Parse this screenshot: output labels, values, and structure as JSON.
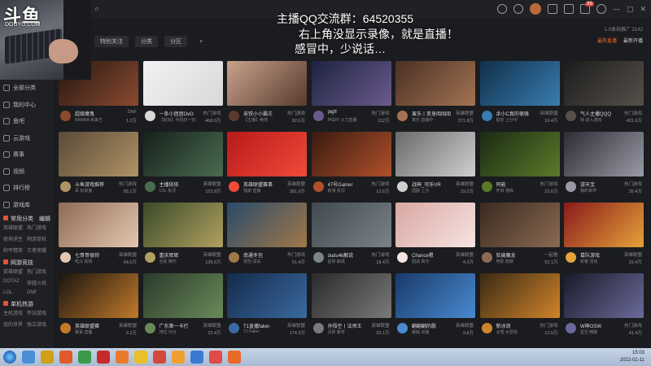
{
  "app": {
    "brand": "斗鱼",
    "brand_url": "DOUYU.COM",
    "top_meta": "1.0本站推广 2142",
    "notification_count": "99"
  },
  "overlay": {
    "line1": "主播QQ交流群：64520355",
    "line2": "右上角没显示录像，就是直播！",
    "line3": "感冒中，少说话…"
  },
  "filters": [
    "特别关注",
    "分类",
    "分区"
  ],
  "right_actions": {
    "hot": "最热直播",
    "new": "最新开播"
  },
  "sidebar": {
    "items": [
      {
        "label": "全部分类",
        "icon": "grid-icon"
      },
      {
        "label": "我的中心",
        "icon": "user-icon"
      },
      {
        "label": "鱼吧",
        "icon": "fish-icon"
      },
      {
        "label": "云游戏",
        "icon": "cloud-icon"
      },
      {
        "label": "赛事",
        "icon": "trophy-icon"
      },
      {
        "label": "视频",
        "icon": "video-icon"
      },
      {
        "label": "排行榜",
        "icon": "rank-icon"
      },
      {
        "label": "游戏库",
        "icon": "gamepad-icon"
      }
    ],
    "sections": [
      {
        "title": "常用分类",
        "action": "编辑",
        "subs": [
          "英雄联盟",
          "热门游戏",
          "绝地求生",
          "网游单机",
          "和平精英",
          "王者荣耀"
        ]
      },
      {
        "title": "网游竞技",
        "action": "",
        "subs": [
          "英雄联盟",
          "热门游戏",
          "DOTA2",
          "穿越火线",
          "LOL",
          "DNF"
        ]
      },
      {
        "title": "单机热游",
        "action": "",
        "subs": [
          "主机游戏",
          "怀旧游戏",
          "我的世界",
          "独立游戏"
        ]
      }
    ],
    "bottom": [
      {
        "label": "开播"
      },
      {
        "label": "直播"
      }
    ]
  },
  "cards": [
    {
      "name": "超级魔鬼",
      "cat": "DNF",
      "sub": "NNNNA 未来已",
      "views": "1.2万",
      "thumb": [
        "#241613",
        "#8a4a2e"
      ]
    },
    {
      "name": "一条小团团OvO",
      "cat": "热门游戏",
      "sub": "【好好】手机扫一扫",
      "views": "468.0万",
      "thumb": [
        "#f2f2f2",
        "#d8d8d8"
      ]
    },
    {
      "name": "采铁小小霸王",
      "cat": "热门游戏",
      "sub": "【主播】绝地",
      "views": "92.6万",
      "thumb": [
        "#c7a38c",
        "#5a3a2f"
      ]
    },
    {
      "name": "pigff",
      "cat": "热门游戏",
      "sub": "PIGFF 火力直播",
      "views": "112万",
      "thumb": [
        "#1e2340",
        "#6a5a8c"
      ]
    },
    {
      "name": "寅乐丨变身阅阅阅",
      "cat": "英雄联盟",
      "sub": "寅乐 直播中",
      "views": "371.8万",
      "thumb": [
        "#4a3025",
        "#a37352"
      ]
    },
    {
      "name": "余小C真的很强",
      "cat": "英雄联盟",
      "sub": "稳定 上分中",
      "views": "10.4万",
      "thumb": [
        "#10304a",
        "#3a7cb0"
      ]
    },
    {
      "name": "气人主播QQQ",
      "cat": "热门游戏",
      "sub": "快 进入游戏",
      "views": "431.6万",
      "thumb": [
        "#1c1c1c",
        "#55504a"
      ]
    },
    {
      "name": "斗鱼游戏推荐",
      "cat": "热门游戏",
      "sub": "百 玩家鬼",
      "views": "85.1万",
      "thumb": [
        "#5a4a38",
        "#b09366"
      ]
    },
    {
      "name": "主播依依",
      "cat": "英雄联盟",
      "sub": "LOL 实况",
      "views": "153.8万",
      "thumb": [
        "#16211c",
        "#4b6b4f"
      ]
    },
    {
      "name": "英雄联盟赛事",
      "cat": "英雄联盟",
      "sub": "独家 直播",
      "views": "281.9万",
      "thumb": [
        "#b81a1a",
        "#f04a3a"
      ]
    },
    {
      "name": "47号Gamer",
      "cat": "热门游戏",
      "sub": "新游 实况",
      "views": "12.6万",
      "thumb": [
        "#3a1a10",
        "#b0502a"
      ]
    },
    {
      "name": "战神_可乐VR",
      "cat": "英雄联盟",
      "sub": "国服 上分",
      "views": "19.2万",
      "thumb": [
        "#6a6a6a",
        "#d0cfd0"
      ]
    },
    {
      "name": "阿能",
      "cat": "热门游戏",
      "sub": "怀旧 游戏",
      "views": "22.6万",
      "thumb": [
        "#1a2b14",
        "#5a7a2a"
      ]
    },
    {
      "name": "游天宝",
      "cat": "热门游戏",
      "sub": "我的世界",
      "views": "35.4万",
      "thumb": [
        "#2c2c36",
        "#9a9aa6"
      ]
    },
    {
      "name": "七哥哥很帅",
      "cat": "英雄联盟",
      "sub": "吃瓜 看戏",
      "views": "64.5万",
      "thumb": [
        "#8f6a52",
        "#e4c7b2"
      ]
    },
    {
      "name": "重庆辉辉",
      "cat": "英雄联盟",
      "sub": "全民 娱乐",
      "views": "128.6万",
      "thumb": [
        "#3a4a28",
        "#b0a060"
      ]
    },
    {
      "name": "南通冬包",
      "cat": "热门游戏",
      "sub": "冒险 闯关",
      "views": "51.4万",
      "thumb": [
        "#2a4a6a",
        "#a07848"
      ]
    },
    {
      "name": "dudu4k解说",
      "cat": "热门游戏",
      "sub": "星际 解说",
      "views": "18.4万",
      "thumb": [
        "#404a4e",
        "#7a8488"
      ]
    },
    {
      "name": "Chance嗯",
      "cat": "英雄联盟",
      "sub": "团战 高光",
      "views": "4.3万",
      "thumb": [
        "#d9a7a2",
        "#f5e4e1"
      ]
    },
    {
      "name": "狂扁魔龙",
      "cat": "一起看",
      "sub": "电影 放映",
      "views": "52.1万",
      "thumb": [
        "#3a2a20",
        "#8a6a52"
      ]
    },
    {
      "name": "葛队游戏",
      "cat": "英雄联盟",
      "sub": "新春 活动",
      "views": "22.4万",
      "thumb": [
        "#8a1a1a",
        "#e4a23a"
      ]
    },
    {
      "name": "英雄联盟赛",
      "cat": "英雄联盟",
      "sub": "赛事 直播",
      "views": "9.2万",
      "thumb": [
        "#1a1410",
        "#c27a2a"
      ]
    },
    {
      "name": "广东第一卡打",
      "cat": "英雄联盟",
      "sub": "排位 冲分",
      "views": "22.4万",
      "thumb": [
        "#2a3a2a",
        "#6a8a5a"
      ]
    },
    {
      "name": "T1直播faker",
      "cat": "英雄联盟",
      "sub": "T1 Faker",
      "views": "174.3万",
      "thumb": [
        "#142a4a",
        "#3a6aa0"
      ]
    },
    {
      "name": "孙悟空丨法师王",
      "cat": "英雄联盟",
      "sub": "法师 教学",
      "views": "33.1万",
      "thumb": [
        "#2a2a2a",
        "#7a7a7a"
      ]
    },
    {
      "name": "翻翻翻的歌",
      "cat": "英雄联盟",
      "sub": "歌曲 点播",
      "views": "9.8万",
      "thumb": [
        "#183a6a",
        "#4a8ad0"
      ]
    },
    {
      "name": "新冰浪",
      "cat": "热门游戏",
      "sub": "冰雪 大冒险",
      "views": "12.5万",
      "thumb": [
        "#3a2a14",
        "#d0842a"
      ]
    },
    {
      "name": "W神OSW",
      "cat": "热门游戏",
      "sub": "星空 畅聊",
      "views": "41.4万",
      "thumb": [
        "#1a1a2a",
        "#6a6a9a"
      ]
    }
  ],
  "taskbar": {
    "time": "15:03",
    "date": "2022-01-11",
    "apps": [
      "#4a8fd6",
      "#d0a018",
      "#e05a2a",
      "#3a9a4a",
      "#c82a2a",
      "#ea7a2a",
      "#e8c028",
      "#d44a3a",
      "#f0a030",
      "#3a7ad0",
      "#e04a4a",
      "#ea6a2a"
    ]
  }
}
